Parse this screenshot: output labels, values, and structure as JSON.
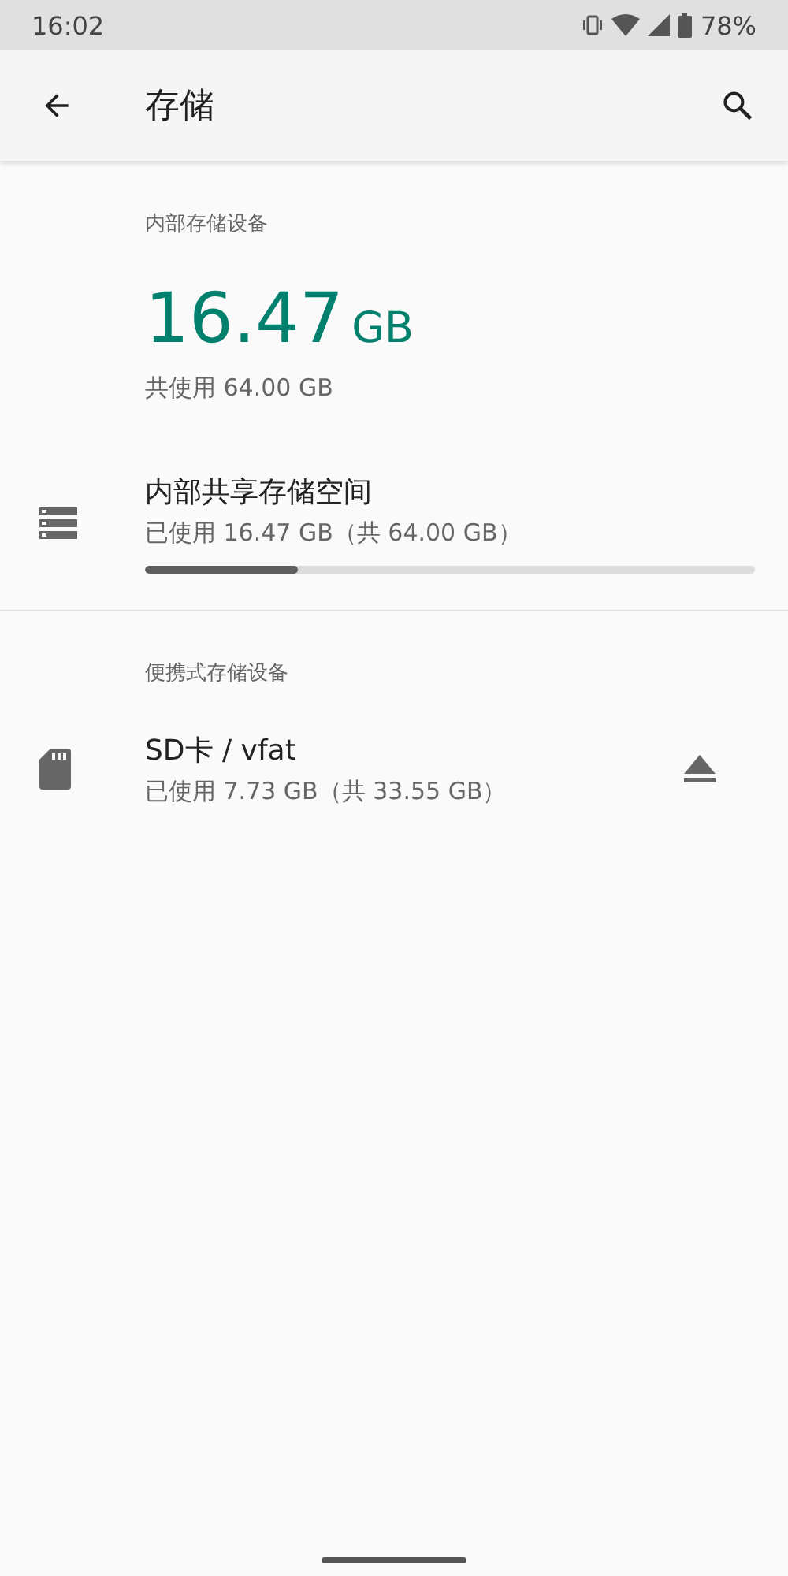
{
  "status_bar": {
    "time": "16:02",
    "battery": "78%"
  },
  "app_bar": {
    "title": "存储"
  },
  "internal": {
    "header": "内部存储设备",
    "used_value": "16.47",
    "used_unit": "GB",
    "total": "共使用 64.00 GB",
    "item": {
      "title": "内部共享存储空间",
      "subtitle": "已使用 16.47 GB（共 64.00 GB）",
      "level": 0.25
    }
  },
  "portable": {
    "header": "便携式存储设备",
    "items": [
      {
        "title": "SD卡 / vfat",
        "subtitle": "已使用 7.73 GB（共 33.55 GB）"
      }
    ]
  }
}
